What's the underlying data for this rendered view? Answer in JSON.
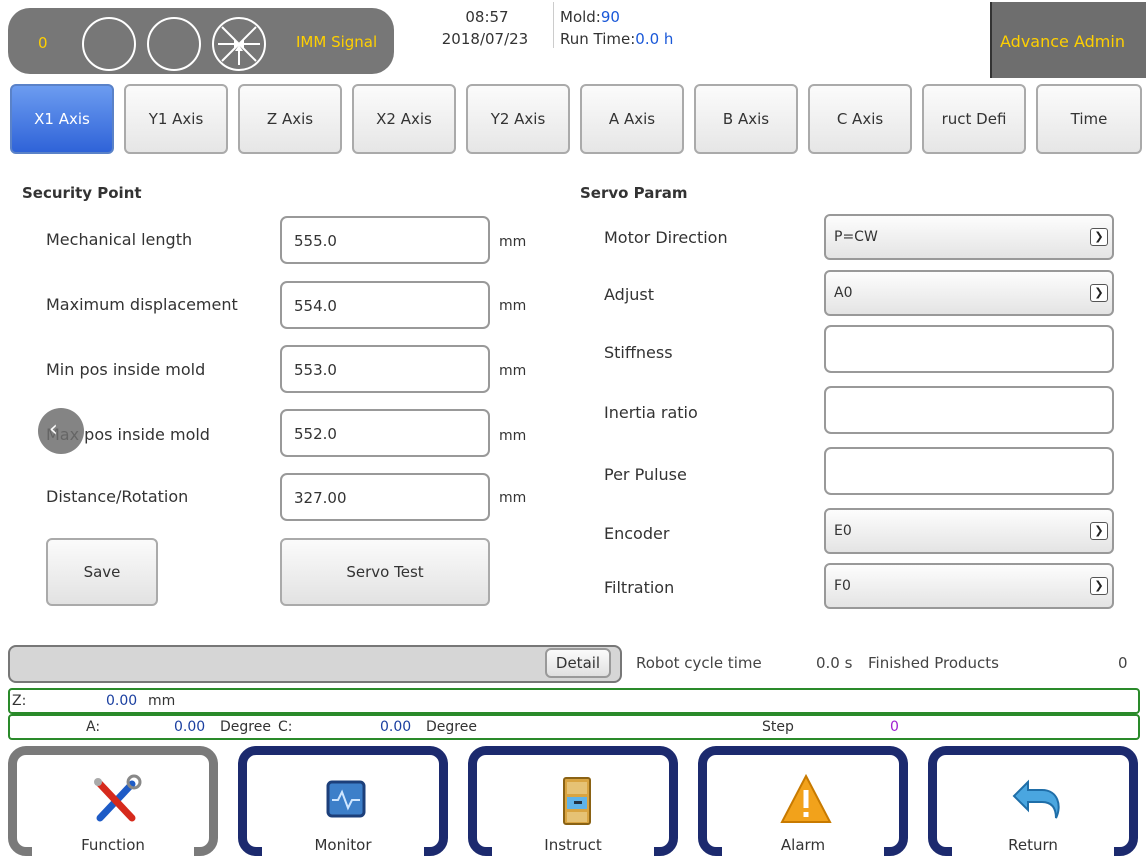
{
  "status": {
    "count": "0",
    "signal_label": "IMM Signal",
    "time": "08:57",
    "date": "2018/07/23",
    "mold_label": "Mold:",
    "mold_value": "90",
    "runtime_label": "Run Time:",
    "runtime_value": "0.0 h",
    "user": "Advance Admin",
    "colors": {
      "accent": "#ffd000",
      "value": "#1a58d8"
    }
  },
  "tabs": [
    {
      "label": "X1 Axis",
      "active": true
    },
    {
      "label": "Y1 Axis"
    },
    {
      "label": "Z Axis"
    },
    {
      "label": "X2 Axis"
    },
    {
      "label": "Y2 Axis"
    },
    {
      "label": "A Axis"
    },
    {
      "label": "B Axis"
    },
    {
      "label": "C Axis"
    },
    {
      "label": "ruct Defi"
    },
    {
      "label": "Time"
    }
  ],
  "security": {
    "title": "Security Point",
    "fields": [
      {
        "label": "Mechanical length",
        "value": "555.0",
        "unit": "mm"
      },
      {
        "label": "Maximum displacement",
        "value": "554.0",
        "unit": "mm"
      },
      {
        "label": "Min pos inside mold",
        "value": "553.0",
        "unit": "mm"
      },
      {
        "label": "Max pos inside mold",
        "value": "552.0",
        "unit": "mm"
      },
      {
        "label": "Distance/Rotation",
        "value": "327.00",
        "unit": "mm"
      }
    ],
    "save_label": "Save",
    "servo_test_label": "Servo Test"
  },
  "servo": {
    "title": "Servo Param",
    "motor_direction": {
      "label": "Motor Direction",
      "value": "P=CW"
    },
    "adjust": {
      "label": "Adjust",
      "value": "A0"
    },
    "stiffness": {
      "label": "Stiffness",
      "value": ""
    },
    "inertia": {
      "label": "Inertia ratio",
      "value": ""
    },
    "per_pulse": {
      "label": "Per Puluse",
      "value": ""
    },
    "encoder": {
      "label": "Encoder",
      "value": "E0"
    },
    "filtration": {
      "label": "Filtration",
      "value": "F0"
    }
  },
  "cycle": {
    "detail_label": "Detail",
    "cycle_label": "Robot cycle time",
    "cycle_value": "0.0 s",
    "finished_label": "Finished Products",
    "finished_value": "0"
  },
  "readout": {
    "z_label": "Z:",
    "z_value": "0.00",
    "z_unit": "mm",
    "a_label": "A:",
    "a_value": "0.00",
    "a_unit": "Degree",
    "c_label": "C:",
    "c_value": "0.00",
    "c_unit": "Degree",
    "step_label": "Step",
    "step_value": "0"
  },
  "nav": {
    "function": "Function",
    "monitor": "Monitor",
    "instruct": "Instruct",
    "alarm": "Alarm",
    "return": "Return"
  },
  "icons": [
    "signal-circle-icon",
    "imm-signal-icon",
    "back-arrow-icon",
    "dropdown-arrow-icon",
    "tools-icon",
    "monitor-icon",
    "cabinet-icon",
    "alarm-icon",
    "return-icon"
  ]
}
